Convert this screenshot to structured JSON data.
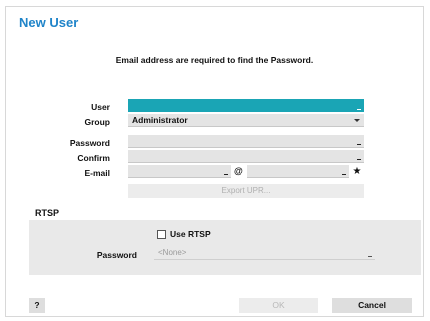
{
  "dialog": {
    "title": "New User",
    "notice": "Email address are required to find the Password."
  },
  "form": {
    "user_label": "User",
    "user_value": "",
    "group_label": "Group",
    "group_value": "Administrator",
    "password_label": "Password",
    "password_value": "",
    "confirm_label": "Confirm",
    "confirm_value": "",
    "email_label": "E-mail",
    "email_local": "",
    "email_at": "@",
    "email_domain": "",
    "export_label": "Export UPR..."
  },
  "rtsp": {
    "section_label": "RTSP",
    "use_rtsp_label": "Use RTSP",
    "use_rtsp_checked": false,
    "password_label": "Password",
    "password_placeholder": "<None>"
  },
  "footer": {
    "help_label": "?",
    "ok_label": "OK",
    "cancel_label": "Cancel"
  },
  "colors": {
    "title": "#1f84c9",
    "active_field": "#1aa5b5"
  },
  "icons": {
    "email_domain_button": "star-icon",
    "group_dropdown": "chevron-down-icon"
  }
}
